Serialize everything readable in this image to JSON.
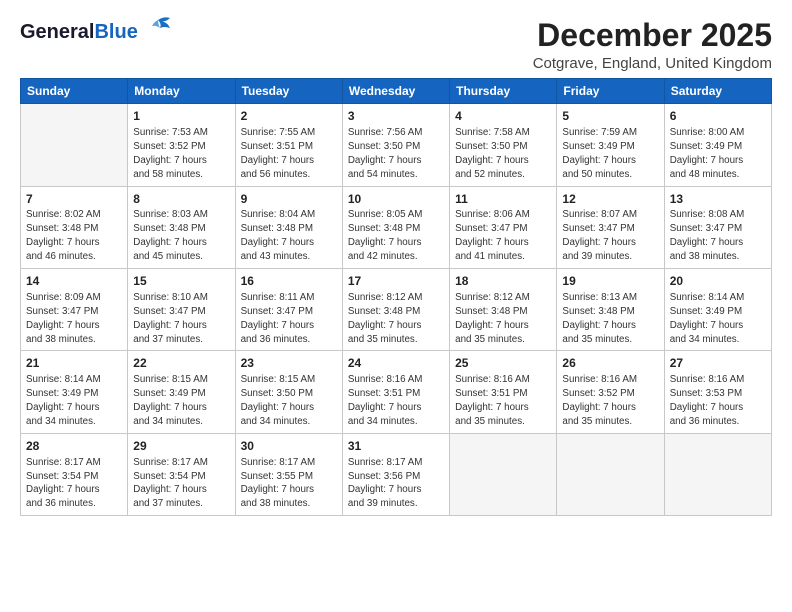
{
  "header": {
    "logo_general": "General",
    "logo_blue": "Blue",
    "title": "December 2025",
    "subtitle": "Cotgrave, England, United Kingdom"
  },
  "calendar": {
    "days_of_week": [
      "Sunday",
      "Monday",
      "Tuesday",
      "Wednesday",
      "Thursday",
      "Friday",
      "Saturday"
    ],
    "weeks": [
      [
        {
          "day": "",
          "info": ""
        },
        {
          "day": "1",
          "info": "Sunrise: 7:53 AM\nSunset: 3:52 PM\nDaylight: 7 hours\nand 58 minutes."
        },
        {
          "day": "2",
          "info": "Sunrise: 7:55 AM\nSunset: 3:51 PM\nDaylight: 7 hours\nand 56 minutes."
        },
        {
          "day": "3",
          "info": "Sunrise: 7:56 AM\nSunset: 3:50 PM\nDaylight: 7 hours\nand 54 minutes."
        },
        {
          "day": "4",
          "info": "Sunrise: 7:58 AM\nSunset: 3:50 PM\nDaylight: 7 hours\nand 52 minutes."
        },
        {
          "day": "5",
          "info": "Sunrise: 7:59 AM\nSunset: 3:49 PM\nDaylight: 7 hours\nand 50 minutes."
        },
        {
          "day": "6",
          "info": "Sunrise: 8:00 AM\nSunset: 3:49 PM\nDaylight: 7 hours\nand 48 minutes."
        }
      ],
      [
        {
          "day": "7",
          "info": "Sunrise: 8:02 AM\nSunset: 3:48 PM\nDaylight: 7 hours\nand 46 minutes."
        },
        {
          "day": "8",
          "info": "Sunrise: 8:03 AM\nSunset: 3:48 PM\nDaylight: 7 hours\nand 45 minutes."
        },
        {
          "day": "9",
          "info": "Sunrise: 8:04 AM\nSunset: 3:48 PM\nDaylight: 7 hours\nand 43 minutes."
        },
        {
          "day": "10",
          "info": "Sunrise: 8:05 AM\nSunset: 3:48 PM\nDaylight: 7 hours\nand 42 minutes."
        },
        {
          "day": "11",
          "info": "Sunrise: 8:06 AM\nSunset: 3:47 PM\nDaylight: 7 hours\nand 41 minutes."
        },
        {
          "day": "12",
          "info": "Sunrise: 8:07 AM\nSunset: 3:47 PM\nDaylight: 7 hours\nand 39 minutes."
        },
        {
          "day": "13",
          "info": "Sunrise: 8:08 AM\nSunset: 3:47 PM\nDaylight: 7 hours\nand 38 minutes."
        }
      ],
      [
        {
          "day": "14",
          "info": "Sunrise: 8:09 AM\nSunset: 3:47 PM\nDaylight: 7 hours\nand 38 minutes."
        },
        {
          "day": "15",
          "info": "Sunrise: 8:10 AM\nSunset: 3:47 PM\nDaylight: 7 hours\nand 37 minutes."
        },
        {
          "day": "16",
          "info": "Sunrise: 8:11 AM\nSunset: 3:47 PM\nDaylight: 7 hours\nand 36 minutes."
        },
        {
          "day": "17",
          "info": "Sunrise: 8:12 AM\nSunset: 3:48 PM\nDaylight: 7 hours\nand 35 minutes."
        },
        {
          "day": "18",
          "info": "Sunrise: 8:12 AM\nSunset: 3:48 PM\nDaylight: 7 hours\nand 35 minutes."
        },
        {
          "day": "19",
          "info": "Sunrise: 8:13 AM\nSunset: 3:48 PM\nDaylight: 7 hours\nand 35 minutes."
        },
        {
          "day": "20",
          "info": "Sunrise: 8:14 AM\nSunset: 3:49 PM\nDaylight: 7 hours\nand 34 minutes."
        }
      ],
      [
        {
          "day": "21",
          "info": "Sunrise: 8:14 AM\nSunset: 3:49 PM\nDaylight: 7 hours\nand 34 minutes."
        },
        {
          "day": "22",
          "info": "Sunrise: 8:15 AM\nSunset: 3:49 PM\nDaylight: 7 hours\nand 34 minutes."
        },
        {
          "day": "23",
          "info": "Sunrise: 8:15 AM\nSunset: 3:50 PM\nDaylight: 7 hours\nand 34 minutes."
        },
        {
          "day": "24",
          "info": "Sunrise: 8:16 AM\nSunset: 3:51 PM\nDaylight: 7 hours\nand 34 minutes."
        },
        {
          "day": "25",
          "info": "Sunrise: 8:16 AM\nSunset: 3:51 PM\nDaylight: 7 hours\nand 35 minutes."
        },
        {
          "day": "26",
          "info": "Sunrise: 8:16 AM\nSunset: 3:52 PM\nDaylight: 7 hours\nand 35 minutes."
        },
        {
          "day": "27",
          "info": "Sunrise: 8:16 AM\nSunset: 3:53 PM\nDaylight: 7 hours\nand 36 minutes."
        }
      ],
      [
        {
          "day": "28",
          "info": "Sunrise: 8:17 AM\nSunset: 3:54 PM\nDaylight: 7 hours\nand 36 minutes."
        },
        {
          "day": "29",
          "info": "Sunrise: 8:17 AM\nSunset: 3:54 PM\nDaylight: 7 hours\nand 37 minutes."
        },
        {
          "day": "30",
          "info": "Sunrise: 8:17 AM\nSunset: 3:55 PM\nDaylight: 7 hours\nand 38 minutes."
        },
        {
          "day": "31",
          "info": "Sunrise: 8:17 AM\nSunset: 3:56 PM\nDaylight: 7 hours\nand 39 minutes."
        },
        {
          "day": "",
          "info": ""
        },
        {
          "day": "",
          "info": ""
        },
        {
          "day": "",
          "info": ""
        }
      ]
    ]
  }
}
